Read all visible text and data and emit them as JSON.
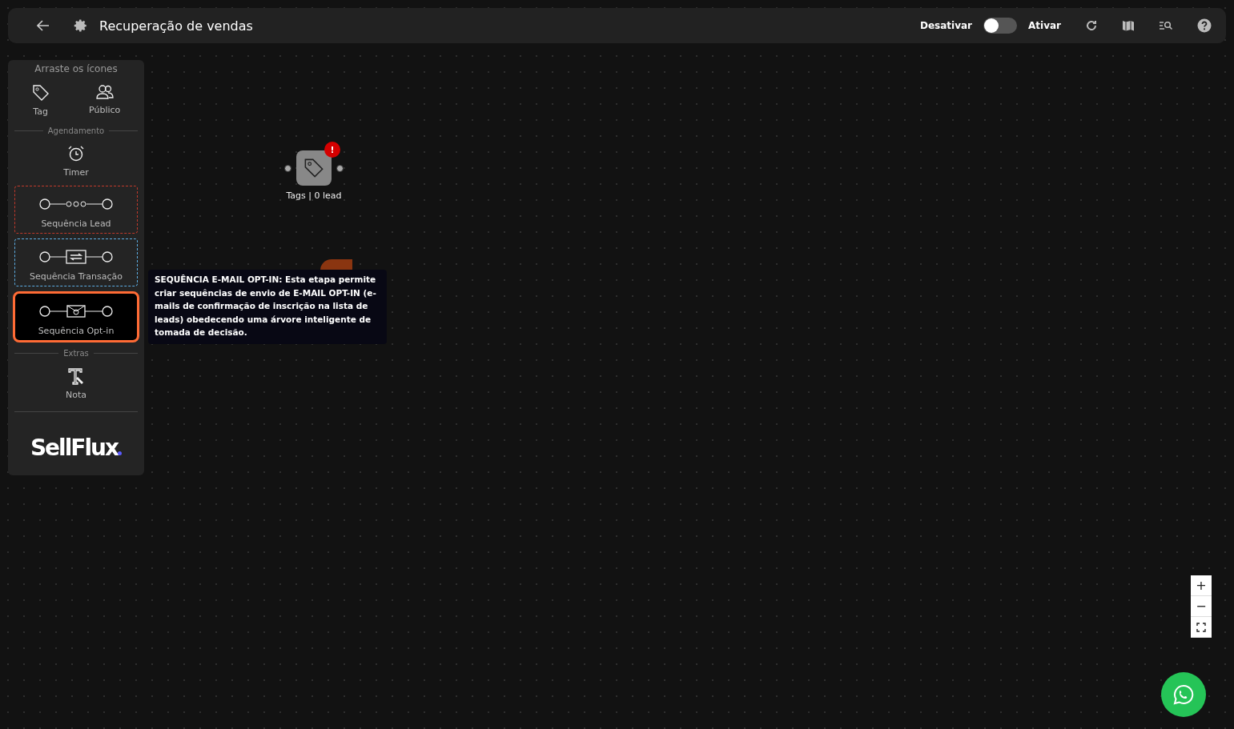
{
  "header": {
    "title": "Recuperação de vendas",
    "toggle_off_label": "Desativar",
    "toggle_on_label": "Ativar",
    "toggle": {
      "on": false
    }
  },
  "palette": {
    "hint": "Arraste os ícones",
    "sections": [
      {
        "items": [
          {
            "kind": "tag",
            "label": "Tag"
          },
          {
            "kind": "audience",
            "label": "Público"
          }
        ]
      },
      {
        "title": "Agendamento",
        "items": [
          {
            "kind": "timer",
            "label": "Timer"
          },
          {
            "kind": "lead-sequence",
            "label": "Sequência Lead",
            "color": "#c0392b",
            "selected": false
          },
          {
            "kind": "transaction-sequence",
            "label": "Sequência Transação",
            "color": "#5dade2",
            "selected": false
          },
          {
            "kind": "optin-sequence",
            "label": "Sequência Opt-in",
            "color": "#ff6b35",
            "selected": true
          }
        ]
      },
      {
        "title": "Extras",
        "items": [
          {
            "kind": "note",
            "label": "Nota"
          }
        ]
      }
    ],
    "logo": "SellFlux"
  },
  "canvas": {
    "nodes": [
      {
        "kind": "tag",
        "label": "Tags | 0 lead",
        "badge": "!"
      }
    ]
  },
  "tooltip": {
    "text": "SEQUÊNCIA E-MAIL OPT-IN: Esta etapa permite criar sequências de envio de E-MAIL OPT-IN (e-mails de confirmação de inscrição na lista de leads) obedecendo uma árvore inteligente de tomada de decisão."
  },
  "zoom_controls": [
    "+",
    "−"
  ]
}
